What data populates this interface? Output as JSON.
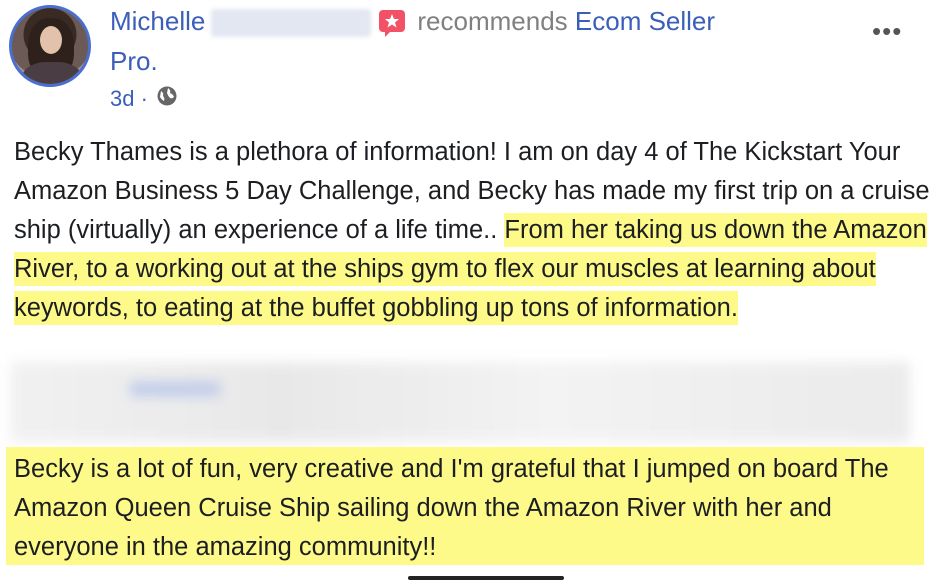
{
  "post": {
    "author_first": "Michelle",
    "action_text": "recommends",
    "page_name_line1": "Ecom Seller",
    "page_name_line2": "Pro.",
    "time": "3d",
    "time_sep": "·"
  },
  "content": {
    "intro": "Becky Thames is a plethora of information! I am on day 4 of The Kickstart Your Amazon Business 5 Day Challenge, and Becky has made my first trip on a cruise ship (virtually) an experience of a life time..",
    "highlight1": "From her taking us down the Amazon River, to a working out at the ships gym to flex our muscles at learning about keywords, to eating at the buffet gobbling up tons of information.",
    "paragraph2": "Becky is a lot of fun, very creative and I'm grateful that I jumped on board The Amazon Queen Cruise Ship sailing down the Amazon River with her and everyone in the amazing community!!"
  },
  "icons": {
    "recommend": "recommend-star-icon",
    "privacy": "globe-icon",
    "more": "more-options-icon"
  },
  "colors": {
    "link": "#3b5eb8",
    "highlight": "#fdfa8a",
    "recommend_badge": "#f25268"
  }
}
